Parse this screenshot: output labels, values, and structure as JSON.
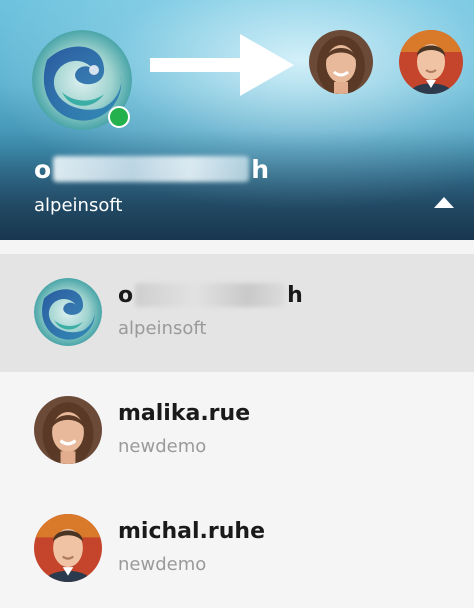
{
  "header": {
    "account": {
      "name_start": "o",
      "name_end": "h",
      "org": "alpeinsoft",
      "status": "online"
    },
    "other_accounts": [
      "malika.rue",
      "michal.ruhe"
    ]
  },
  "accounts": [
    {
      "name_start": "o",
      "name_end": "h",
      "org": "alpeinsoft",
      "selected": true,
      "avatar": "abstract-swirl"
    },
    {
      "name": "malika.rue",
      "org": "newdemo",
      "selected": false,
      "avatar": "woman-portrait"
    },
    {
      "name": "michal.ruhe",
      "org": "newdemo",
      "selected": false,
      "avatar": "man-portrait"
    }
  ],
  "colors": {
    "status_online": "#22b14c",
    "header_top": "#6fc3de",
    "header_bottom": "#24506c",
    "selected_row": "#e4e4e4"
  }
}
